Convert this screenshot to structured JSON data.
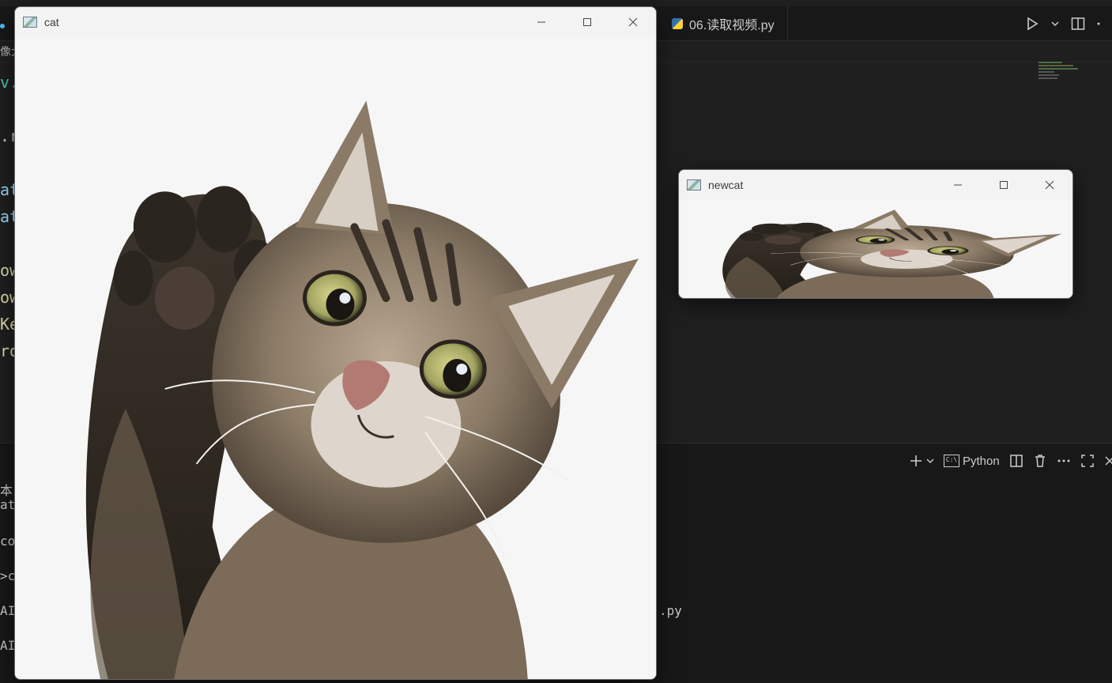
{
  "vscode": {
    "tabs": [
      {
        "label": "06.读取视频.py"
      }
    ],
    "breadcrumb_fragment": "像大",
    "code_fragments": [
      "v.",
      ".r",
      "at",
      "at",
      "ow",
      "ow",
      "Ke",
      "ro"
    ],
    "panel": {
      "profile_label": "Python",
      "term_fragments": [
        "本",
        "ati",
        "cor",
        ">cc",
        "AI",
        "AI"
      ],
      "term_file_suffix": ".py"
    }
  },
  "windows": {
    "cat": {
      "title": "cat",
      "icons": [
        "window-app-icon",
        "minimize-icon",
        "maximize-icon",
        "close-icon"
      ]
    },
    "newcat": {
      "title": "newcat",
      "icons": [
        "window-app-icon",
        "minimize-icon",
        "maximize-icon",
        "close-icon"
      ]
    }
  },
  "colors": {
    "editor_bg": "#1f1f1f",
    "window_bg": "#f6f6f7",
    "code_yellow": "#dcdcaa",
    "code_blue": "#9cdcfe"
  }
}
